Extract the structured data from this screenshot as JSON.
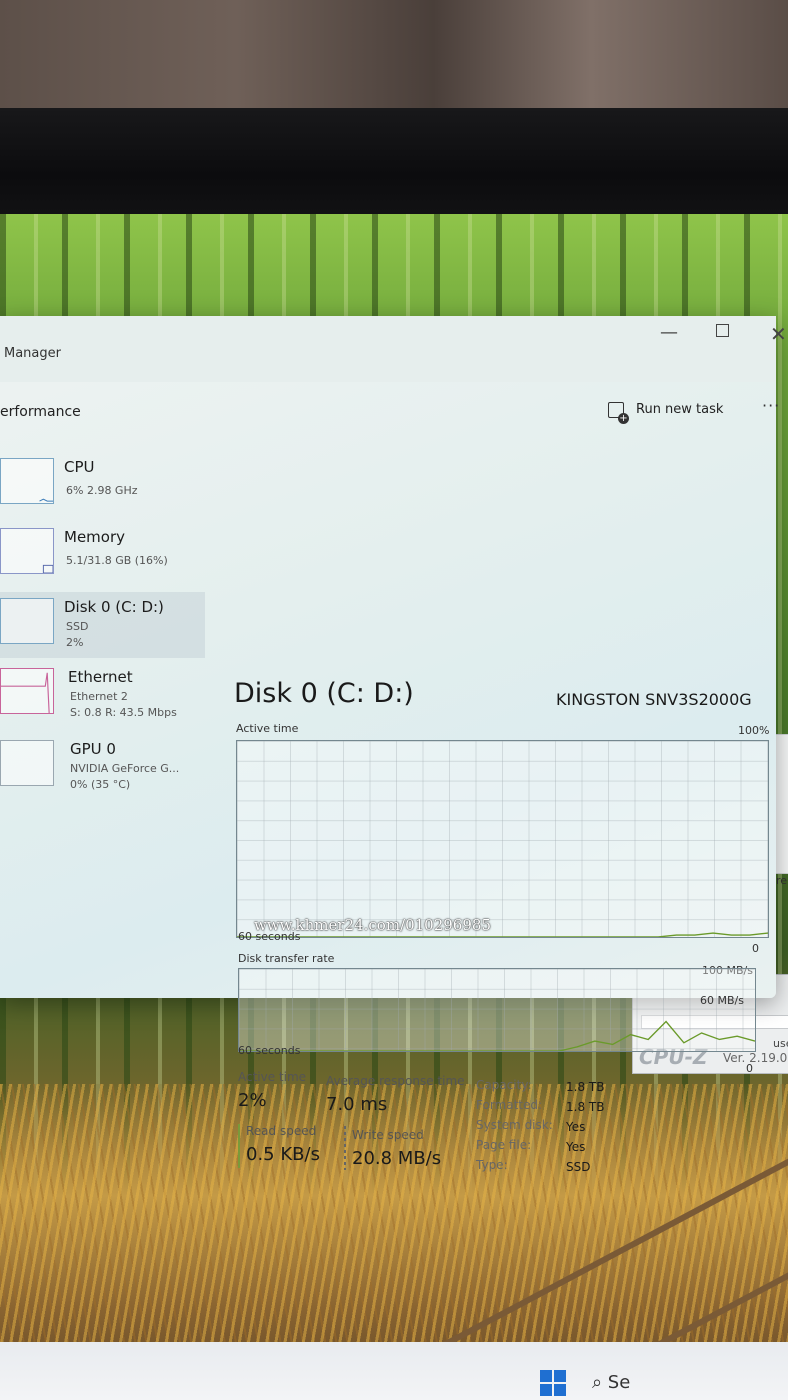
{
  "window": {
    "app_title_partial": "Manager",
    "page_title_partial": "erformance",
    "run_new_task": "Run new task",
    "more": "···",
    "min_glyph": "—",
    "close_glyph": "✕"
  },
  "sidebar": {
    "items": [
      {
        "name": "CPU",
        "sub1": "6% 2.98 GHz",
        "sub2": ""
      },
      {
        "name": "Memory",
        "sub1": "5.1/31.8 GB (16%)",
        "sub2": ""
      },
      {
        "name": "Disk 0 (C: D:)",
        "sub1": "SSD",
        "sub2": "2%"
      },
      {
        "name": "Ethernet",
        "sub1": "Ethernet 2",
        "sub2": "S: 0.8  R: 43.5 Mbps"
      },
      {
        "name": "GPU 0",
        "sub1": "NVIDIA GeForce G...",
        "sub2": "0% (35 °C)"
      }
    ]
  },
  "disk": {
    "title": "Disk 0 (C: D:)",
    "model": "KINGSTON SNV3S2000G",
    "active_time_label": "Active time",
    "active_time_max": "100%",
    "graph1_seconds": "60 seconds",
    "graph1_min": "0",
    "transfer_label": "Disk transfer rate",
    "transfer_max": "100 MB/s",
    "transfer_mid": "60 MB/s",
    "graph2_seconds": "60 seconds",
    "graph2_min": "0",
    "transfer_series": [
      0,
      0,
      0,
      0,
      0,
      0,
      0,
      0,
      0,
      0,
      0,
      0,
      0,
      0,
      0,
      0,
      0,
      0,
      0,
      5,
      12,
      8,
      20,
      14,
      36,
      10,
      22,
      14,
      18,
      12
    ],
    "active_series": [
      0,
      0,
      0,
      0,
      0,
      0,
      0,
      0,
      0,
      0,
      0,
      0,
      0,
      0,
      0,
      0,
      0,
      0,
      0,
      0,
      0,
      0,
      0,
      0,
      1,
      1,
      2,
      1,
      1,
      2
    ]
  },
  "stats": {
    "active_time_label": "Active time",
    "active_time_value": "2%",
    "avg_resp_label": "Average response time",
    "avg_resp_value": "7.0 ms",
    "read_label": "Read speed",
    "read_value": "0.5 KB/s",
    "write_label": "Write speed",
    "write_value": "20.8 MB/s"
  },
  "props": [
    {
      "k": "Capacity:",
      "v": "1.8 TB"
    },
    {
      "k": "Formatted:",
      "v": "1.8 TB"
    },
    {
      "k": "System disk:",
      "v": "Yes"
    },
    {
      "k": "Page file:",
      "v": "Yes"
    },
    {
      "k": "Type:",
      "v": "SSD"
    }
  ],
  "background": {
    "cpuz_brand": "CPU-Z",
    "cpuz_version": "Ver. 2.19.0.",
    "cpuz_partial": "use",
    "peek_partial": "re",
    "taskbar_search": "⌕ Se"
  },
  "watermark": "www.khmer24.com/010296985",
  "colors": {
    "disk_series": "#6a9a2a",
    "ethernet_accent": "#c8649a",
    "windows_blue": "#1f6fd1"
  }
}
